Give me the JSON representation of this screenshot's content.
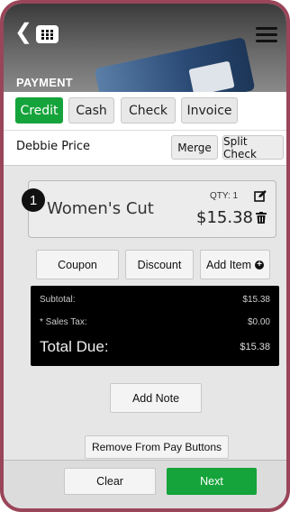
{
  "header": {
    "back_icon": "chevron-left-icon",
    "grid_icon": "grid-icon",
    "menu_icon": "hamburger-menu-icon",
    "section_title": "PAYMENT"
  },
  "payment_tabs": [
    {
      "label": "Credit",
      "active": true
    },
    {
      "label": "Cash",
      "active": false
    },
    {
      "label": "Check",
      "active": false
    },
    {
      "label": "Invoice",
      "active": false
    }
  ],
  "customer": {
    "name": "Debbie Price",
    "merge_label": "Merge",
    "split_label": "Split Check"
  },
  "line_item": {
    "number": "1",
    "name": "Women's Cut",
    "qty": "QTY: 1",
    "price": "$15.38",
    "edit_icon": "edit-icon",
    "delete_icon": "trash-icon"
  },
  "actions": {
    "coupon": "Coupon",
    "discount": "Discount",
    "add_item": "Add Item"
  },
  "totals": {
    "subtotal_label": "Subtotal:",
    "subtotal_value": "$15.38",
    "tax_label": "* Sales Tax:",
    "tax_value": "$0.00",
    "total_label": "Total Due:",
    "total_value": "$15.38"
  },
  "add_note_label": "Add Note",
  "remove_label": "Remove From Pay Buttons",
  "footer": {
    "clear_label": "Clear",
    "next_label": "Next"
  },
  "colors": {
    "frame": "#9a4559",
    "accent_green": "#15a33b",
    "totals_bg": "#000000"
  }
}
